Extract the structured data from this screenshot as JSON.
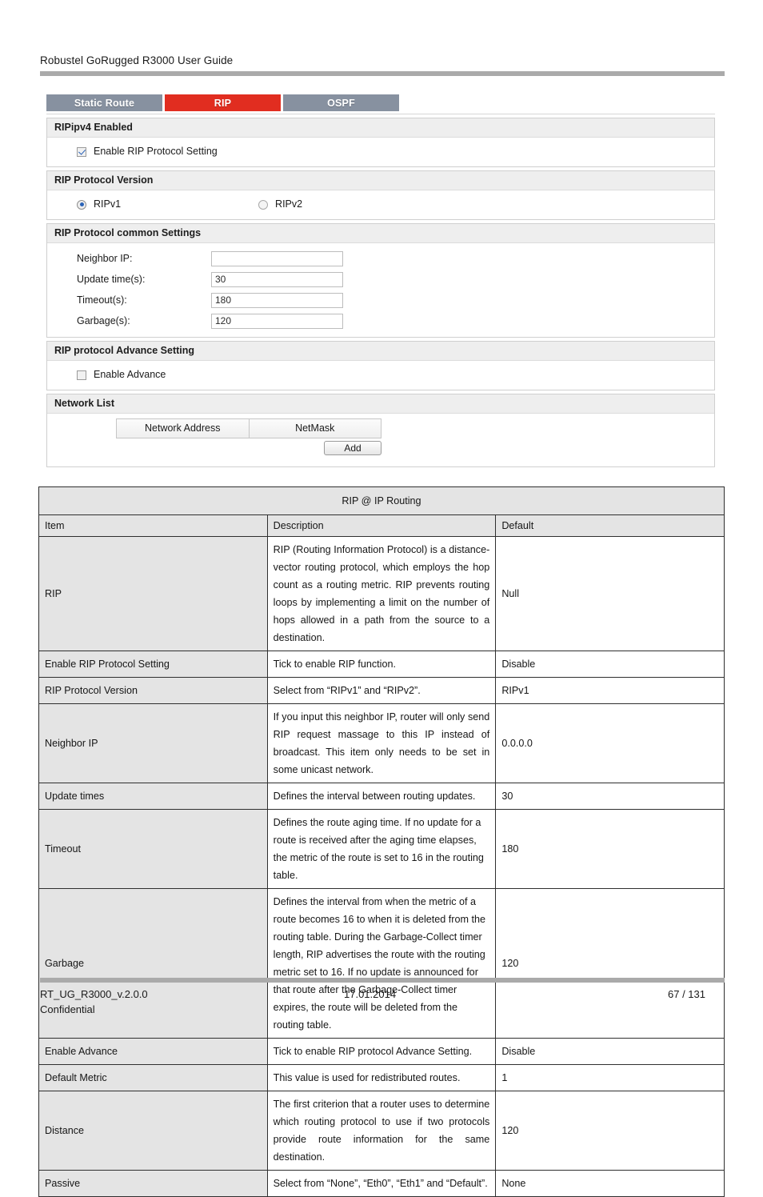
{
  "document": {
    "header_title": "Robustel GoRugged R3000 User Guide",
    "footer": {
      "doc_id": "RT_UG_R3000_v.2.0.0",
      "date": "17.01.2014",
      "page": "67 / 131",
      "classification": "Confidential"
    }
  },
  "webui": {
    "tabs": [
      {
        "label": "Static Route",
        "active": false
      },
      {
        "label": "RIP",
        "active": true
      },
      {
        "label": "OSPF",
        "active": false
      }
    ],
    "sections": {
      "ripipv4": {
        "title": "RIPipv4 Enabled",
        "checkbox_label": "Enable RIP Protocol Setting",
        "checked": "true"
      },
      "version": {
        "title": "RIP Protocol Version",
        "option1": "RIPv1",
        "option2": "RIPv2",
        "selected": "RIPv1"
      },
      "common": {
        "title": "RIP Protocol common Settings",
        "fields": [
          {
            "label": "Neighbor IP:",
            "value": ""
          },
          {
            "label": "Update time(s):",
            "value": "30"
          },
          {
            "label": "Timeout(s):",
            "value": "180"
          },
          {
            "label": "Garbage(s):",
            "value": "120"
          }
        ]
      },
      "advance": {
        "title": "RIP protocol Advance Setting",
        "checkbox_label": "Enable Advance",
        "checked": "false"
      },
      "network_list": {
        "title": "Network List",
        "columns": [
          "Network Address",
          "NetMask"
        ],
        "add_label": "Add"
      }
    }
  },
  "reference_table": {
    "title": "RIP @ IP Routing",
    "columns": [
      "Item",
      "Description",
      "Default"
    ],
    "rows": [
      {
        "item": "RIP",
        "description": "RIP (Routing Information Protocol) is a distance-vector routing protocol, which employs the hop count as a routing metric. RIP prevents routing loops by implementing a limit on the number of hops allowed in a path from the source to a destination.",
        "default": "Null"
      },
      {
        "item": "Enable RIP Protocol Setting",
        "description": "Tick to enable RIP function.",
        "default": "Disable"
      },
      {
        "item": "RIP Protocol Version",
        "description": "Select from “RIPv1” and “RIPv2”.",
        "default": "RIPv1"
      },
      {
        "item": "Neighbor IP",
        "description": "If you input this neighbor IP, router will only send RIP request massage to this IP instead of broadcast. This item only needs to be set in some unicast network.",
        "default": "0.0.0.0"
      },
      {
        "item": "Update times",
        "description": "Defines the interval between routing updates.",
        "default": "30"
      },
      {
        "item": "Timeout",
        "description": "Defines the route aging time. If no update for a route is received after the aging time elapses, the metric of the route is set to 16 in the routing table.",
        "default": "180"
      },
      {
        "item": "Garbage",
        "description": "Defines the interval from when the metric of a route becomes 16 to when it is deleted from the routing table. During the Garbage-Collect timer length, RIP advertises the route with the routing metric set to 16. If no update is announced for that route after the Garbage-Collect timer expires, the route will be deleted from the routing table.",
        "default": "120"
      },
      {
        "item": "Enable Advance",
        "description": "Tick to enable RIP protocol Advance Setting.",
        "default": "Disable"
      },
      {
        "item": "Default Metric",
        "description": "This value is used for redistributed routes.",
        "default": "1"
      },
      {
        "item": "Distance",
        "description": "The first criterion that a router uses to determine which routing protocol to use if two protocols provide route information for the same destination.",
        "default": "120"
      },
      {
        "item": "Passive",
        "description": "Select from “None”, “Eth0”, “Eth1” and “Default”.",
        "default": "None"
      }
    ]
  },
  "colors": {
    "tab_inactive": "#8791a0",
    "tab_active": "#e12d20",
    "rule": "#aaaaaa",
    "panel_head": "#eeeeee",
    "table_shade": "#e4e4e4"
  }
}
